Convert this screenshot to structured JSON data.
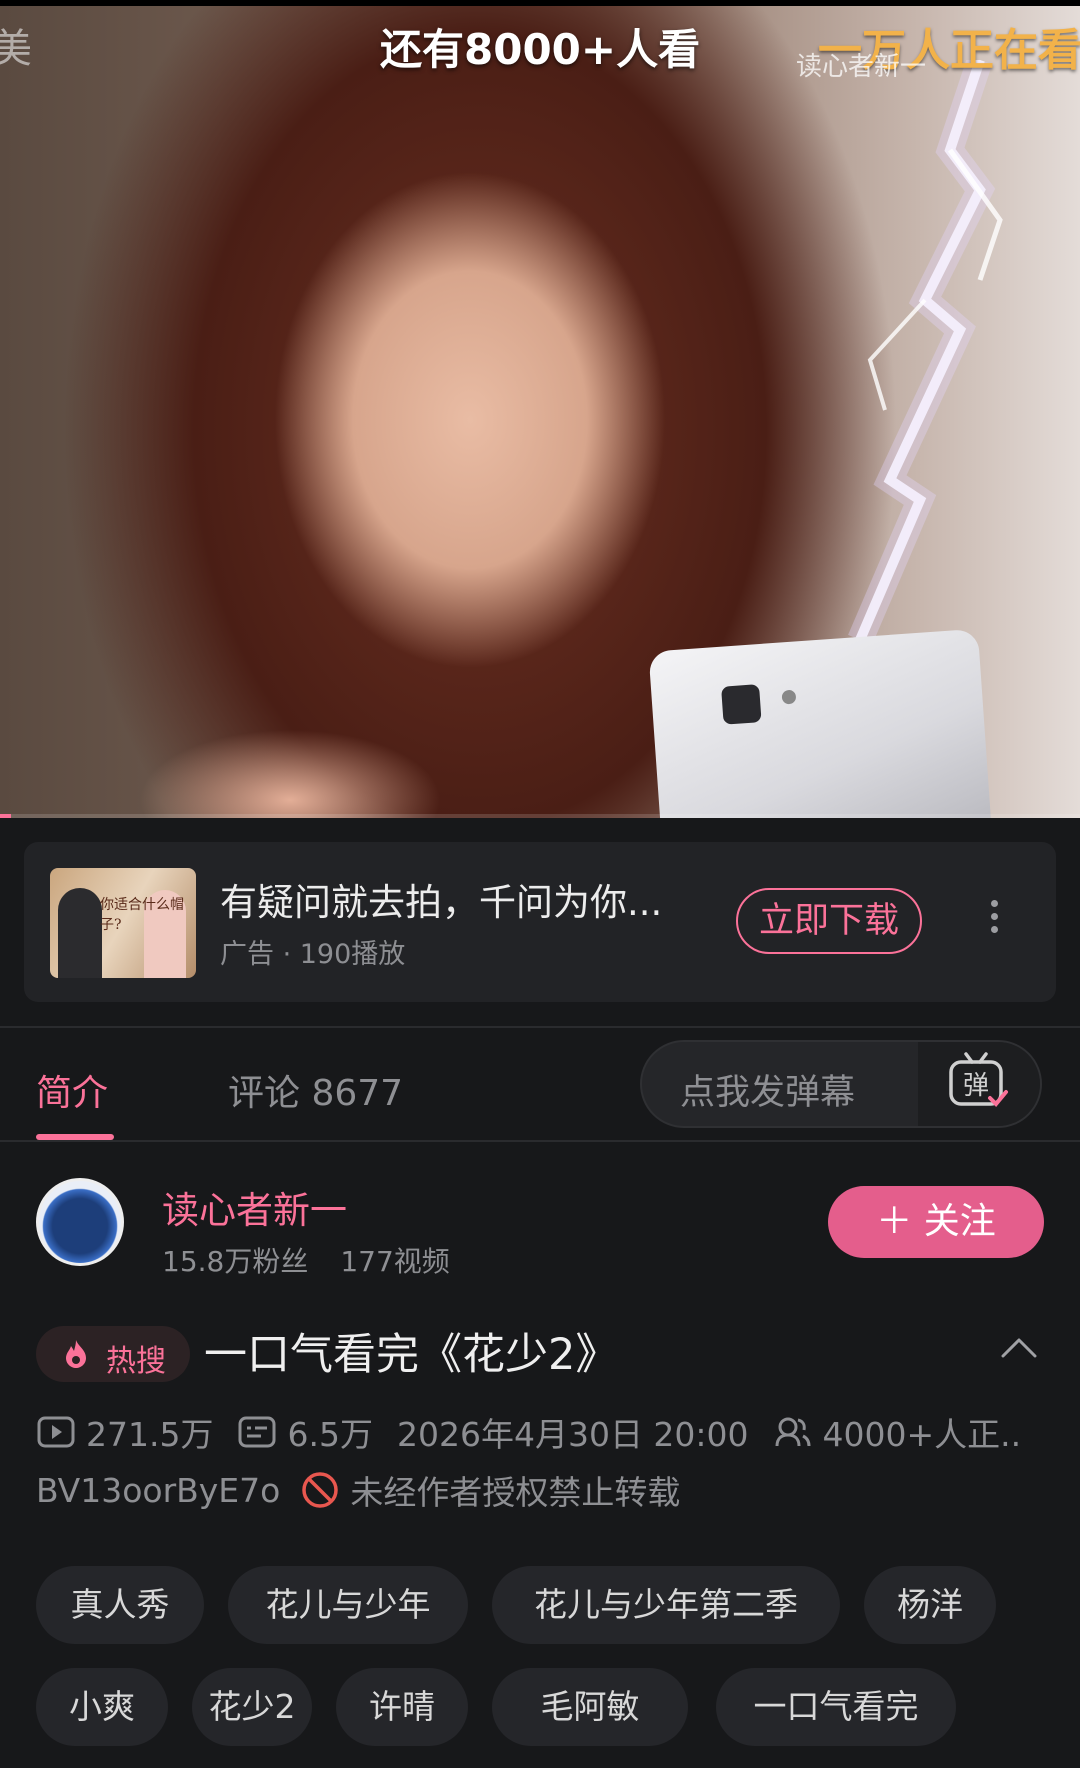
{
  "video": {
    "left_text": "美",
    "top_text": "还有8000+人看",
    "danmaku": "一万人正在看",
    "watermark": "读心者新一",
    "progress_fraction": 0.01
  },
  "ad": {
    "thumb_text": "你适合什么帽子?",
    "title": "有疑问就去拍，千问为你...",
    "subtitle": "广告 · 190播放",
    "download_label": "立即下载"
  },
  "tabs": {
    "intro_label": "简介",
    "comments_label": "评论 8677",
    "danmaku_placeholder": "点我发弹幕",
    "danmaku_icon_char": "弹"
  },
  "uploader": {
    "name": "读心者新一",
    "fans": "15.8万粉丝",
    "videos": "177视频",
    "follow_label": "＋ 关注"
  },
  "video_info": {
    "hot_label": "热搜",
    "title": "一口气看完《花少2》",
    "views": "271.5万",
    "danmaku_count": "6.5万",
    "datetime": "2026年4月30日 20:00",
    "watching": "4000+人正..",
    "bvid": "BV13oorByE7o",
    "copyright": "未经作者授权禁止转载"
  },
  "tags": [
    "真人秀",
    "花儿与少年",
    "花儿与少年第二季",
    "杨洋",
    "小爽",
    "花少2",
    "许晴",
    "毛阿敏",
    "一口气看完"
  ],
  "colors": {
    "accent": "#fb7299",
    "background": "#17181a",
    "card": "#222326"
  }
}
